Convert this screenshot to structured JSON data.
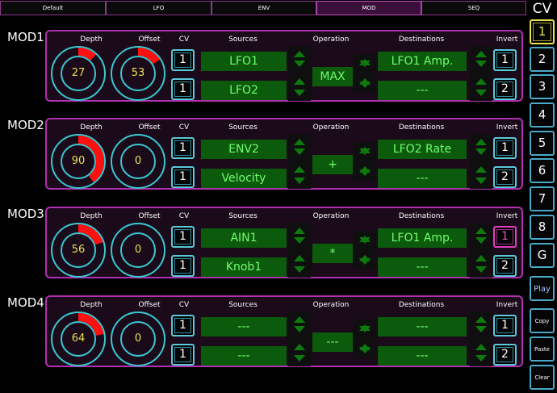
{
  "tabs": [
    {
      "label": "Default",
      "active": false
    },
    {
      "label": "LFO",
      "active": false
    },
    {
      "label": "ENV",
      "active": false
    },
    {
      "label": "MOD",
      "active": true
    },
    {
      "label": "SEQ",
      "active": false
    }
  ],
  "sidebar": {
    "title": "CV",
    "buttons": [
      "1",
      "2",
      "3",
      "4",
      "5",
      "6",
      "7",
      "8",
      "G",
      "Play",
      "Copy",
      "Paste",
      "Clear"
    ],
    "active_index": 0
  },
  "headers": {
    "depth": "Depth",
    "offset": "Offset",
    "cv": "CV",
    "sources": "Sources",
    "operation": "Operation",
    "destinations": "Destinations",
    "invert": "Invert"
  },
  "modules": [
    {
      "title": "MOD1",
      "depth": {
        "value": "27",
        "fraction": 0.12
      },
      "offset": {
        "value": "53",
        "fraction": 0.16
      },
      "cv": [
        "1",
        "1"
      ],
      "sources": [
        "LFO1",
        "LFO2"
      ],
      "operation": "MAX",
      "destinations": [
        "LFO1 Amp.",
        "---"
      ],
      "invert": [
        "1",
        "2"
      ],
      "invert_active": [
        false,
        false
      ]
    },
    {
      "title": "MOD2",
      "depth": {
        "value": "90",
        "fraction": 0.4
      },
      "offset": {
        "value": "0",
        "fraction": 0
      },
      "cv": [
        "1",
        "1"
      ],
      "sources": [
        "ENV2",
        "Velocity"
      ],
      "operation": "+",
      "destinations": [
        "LFO2 Rate",
        "---"
      ],
      "invert": [
        "1",
        "2"
      ],
      "invert_active": [
        false,
        false
      ]
    },
    {
      "title": "MOD3",
      "depth": {
        "value": "56",
        "fraction": 0.2
      },
      "offset": {
        "value": "0",
        "fraction": 0
      },
      "cv": [
        "1",
        "1"
      ],
      "sources": [
        "AIN1",
        "Knob1"
      ],
      "operation": "*",
      "destinations": [
        "LFO1 Amp.",
        "---"
      ],
      "invert": [
        "1",
        "2"
      ],
      "invert_active": [
        true,
        false
      ]
    },
    {
      "title": "MOD4",
      "depth": {
        "value": "64",
        "fraction": 0.22
      },
      "offset": {
        "value": "0",
        "fraction": 0
      },
      "cv": [
        "1",
        "1"
      ],
      "sources": [
        "---",
        "---"
      ],
      "operation": "---",
      "destinations": [
        "---",
        "---"
      ],
      "invert": [
        "1",
        "2"
      ],
      "invert_active": [
        false,
        false
      ]
    }
  ],
  "colors": {
    "accent_frame": "#b030b0",
    "knob_ring": "#3ac8d0",
    "knob_fill": "#ff1010",
    "value_text": "#e8e050",
    "field_bg": "#0c5a0c",
    "field_text": "#70ff70"
  }
}
